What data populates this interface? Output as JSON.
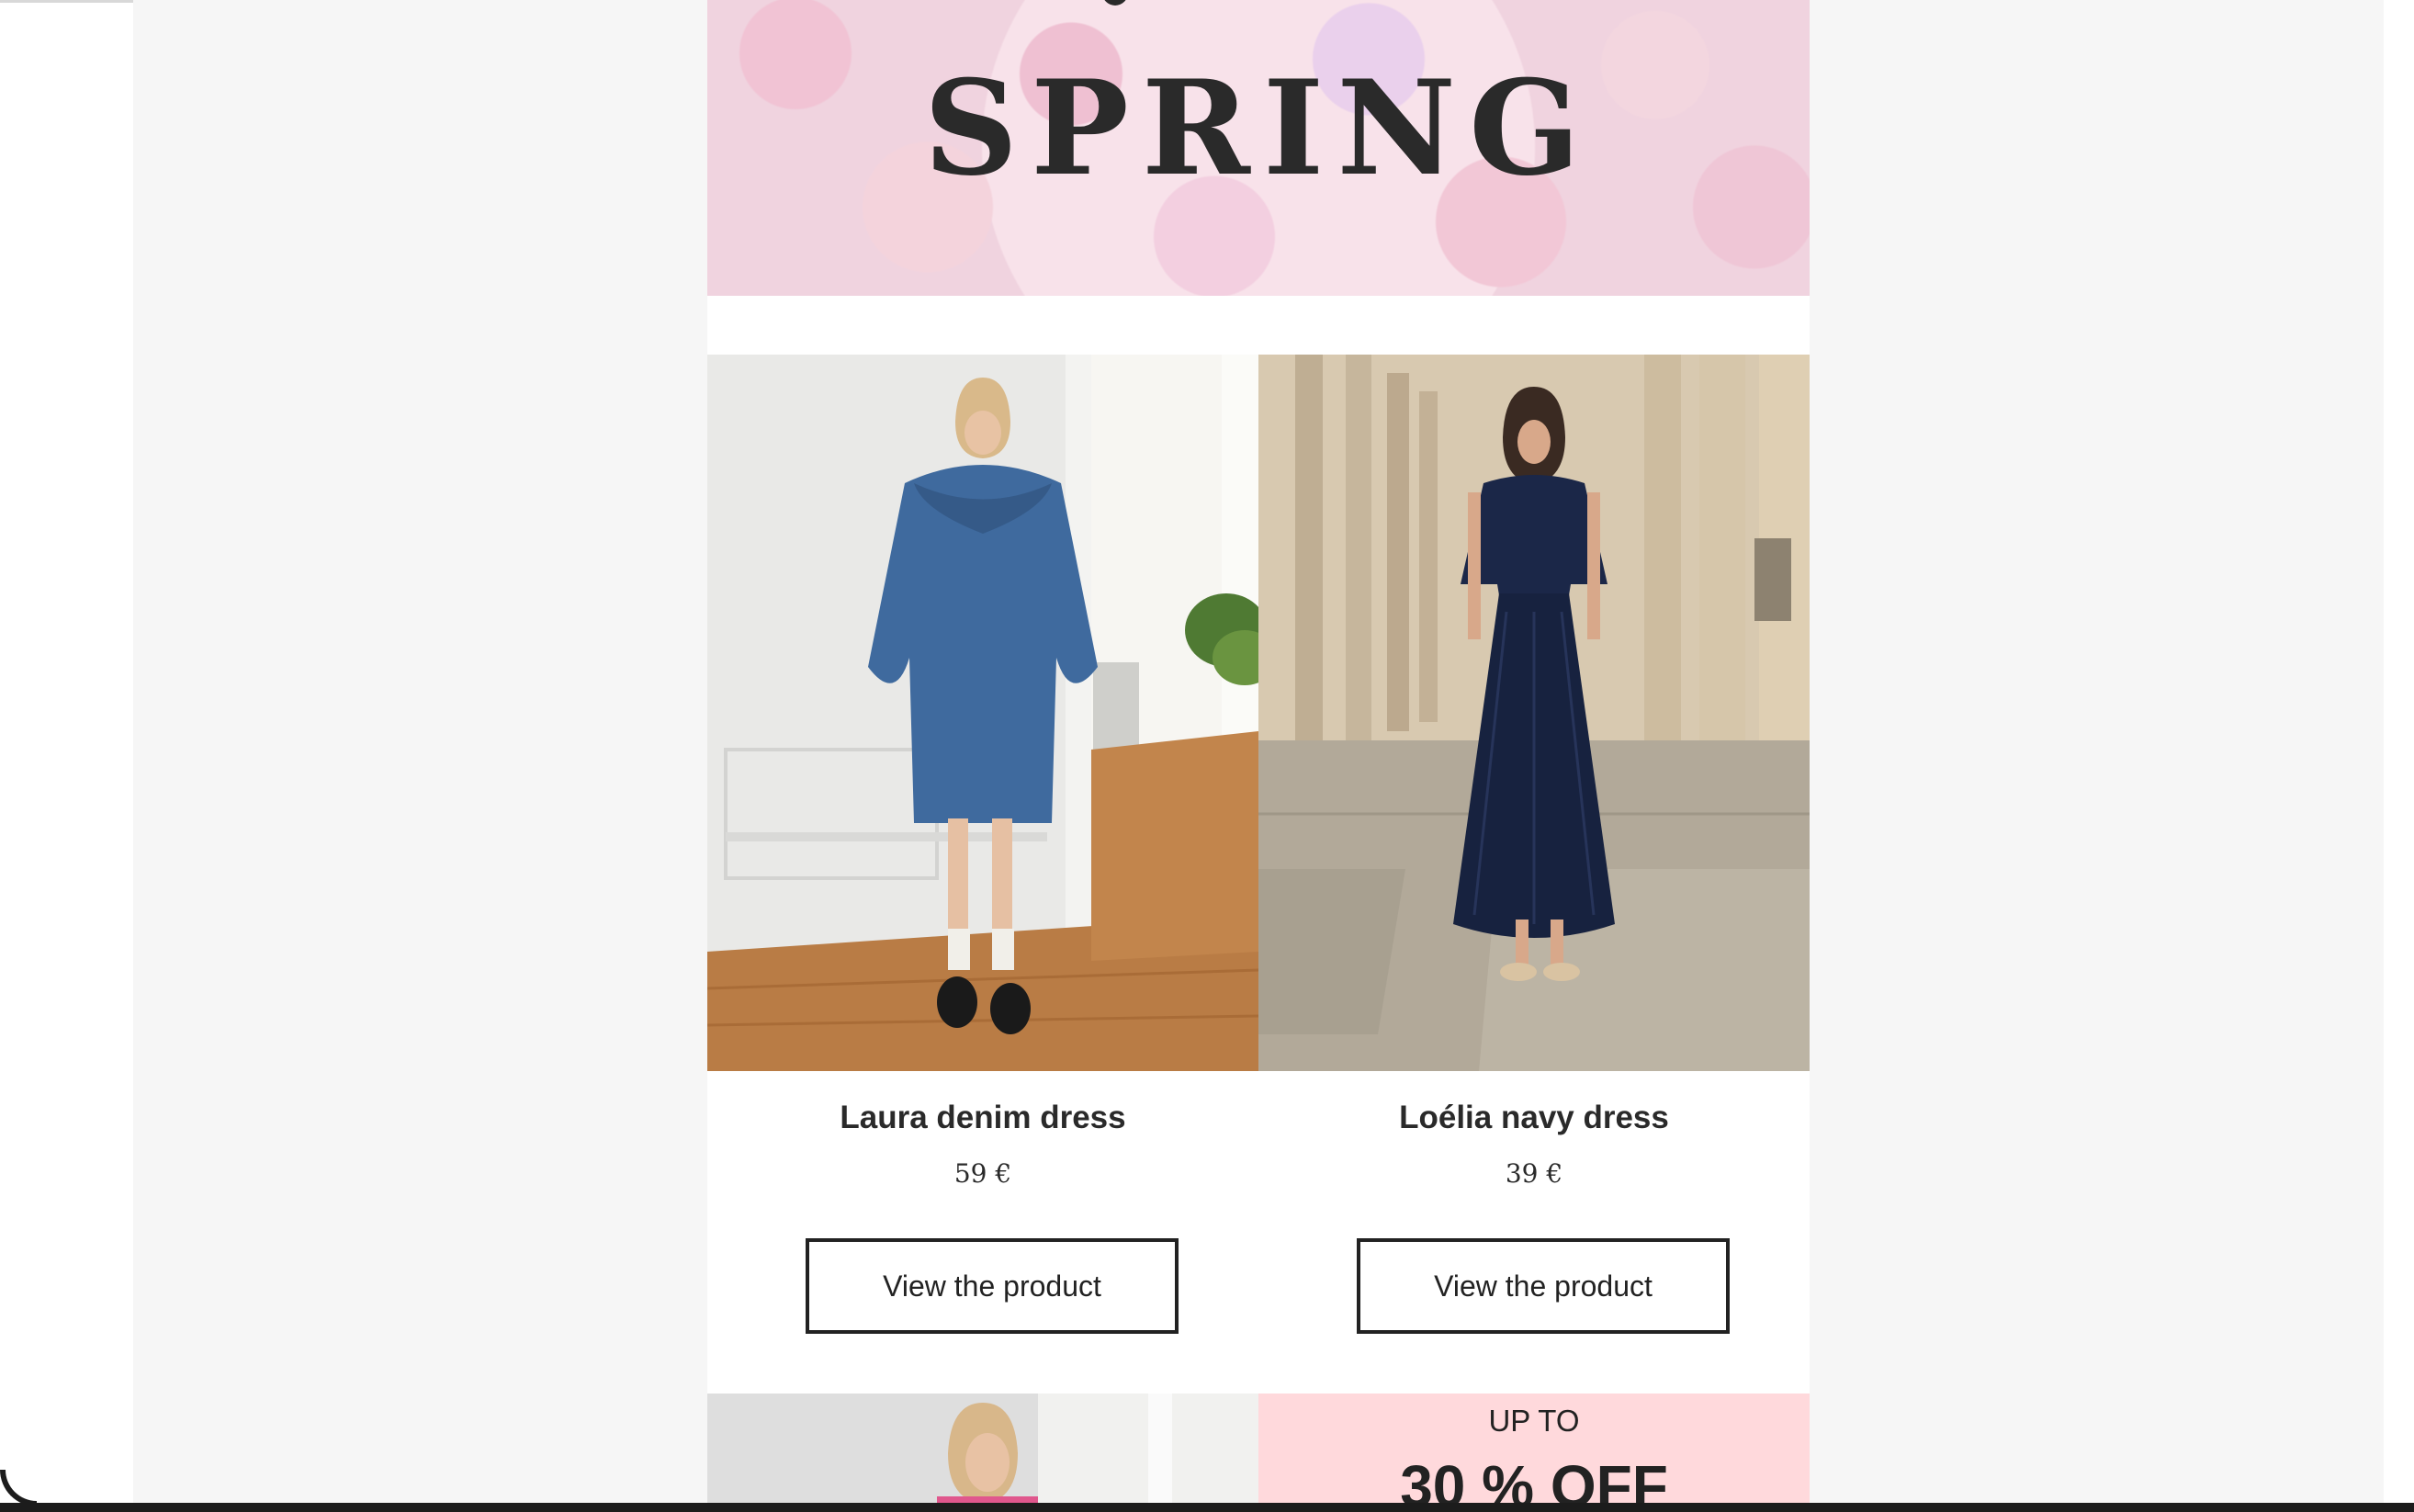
{
  "hero": {
    "title": "SPRING"
  },
  "products": [
    {
      "name": "Laura denim dress",
      "price": "59 €",
      "button_label": "View the product"
    },
    {
      "name": "Loélia navy dress",
      "price": "39 €",
      "button_label": "View the product"
    }
  ],
  "promo": {
    "line1": "UP TO",
    "line2": "30 % OFF"
  },
  "colors": {
    "page_background": "#f6f6f6",
    "email_background": "#ffffff",
    "hero_pink": "#f0d3df",
    "promo_pink": "#ffd9dc",
    "text": "#2a2a2a",
    "denim": "#3f6a9e",
    "navy": "#1b2748"
  }
}
